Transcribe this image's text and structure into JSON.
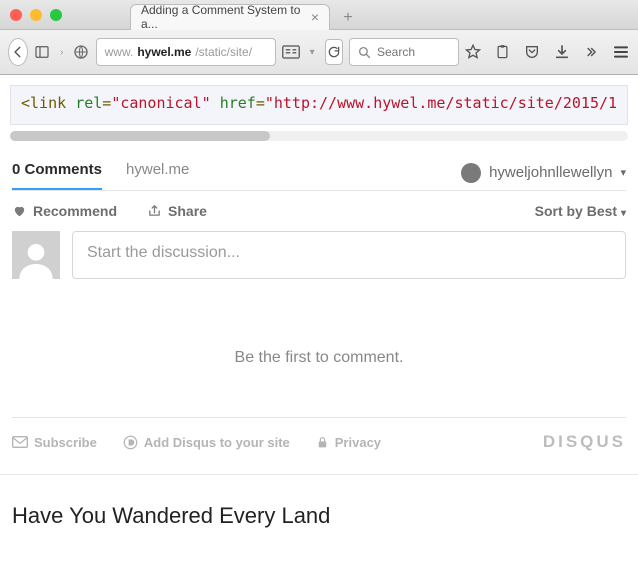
{
  "window": {
    "tab_title": "Adding a Comment System to a...",
    "url_prefix": "www.",
    "url_host": "hywel.me",
    "url_path": "/static/site/",
    "search_placeholder": "Search"
  },
  "code": {
    "tag_open": "<link",
    "attr_rel": "rel",
    "val_rel": "\"canonical\"",
    "attr_href": "href",
    "val_href": "\"http://www.hywel.me/static/site/2015/1",
    "eq": "="
  },
  "disqus": {
    "comments_count_label": "0 Comments",
    "site_label": "hywel.me",
    "username": "hyweljohnllewellyn",
    "recommend": "Recommend",
    "share": "Share",
    "sort_label": "Sort by Best",
    "placeholder": "Start the discussion...",
    "empty": "Be the first to comment.",
    "subscribe": "Subscribe",
    "add_site": "Add Disqus to your site",
    "privacy": "Privacy",
    "brand": "DISQUS"
  },
  "next_post": {
    "title": "Have You Wandered Every Land"
  }
}
